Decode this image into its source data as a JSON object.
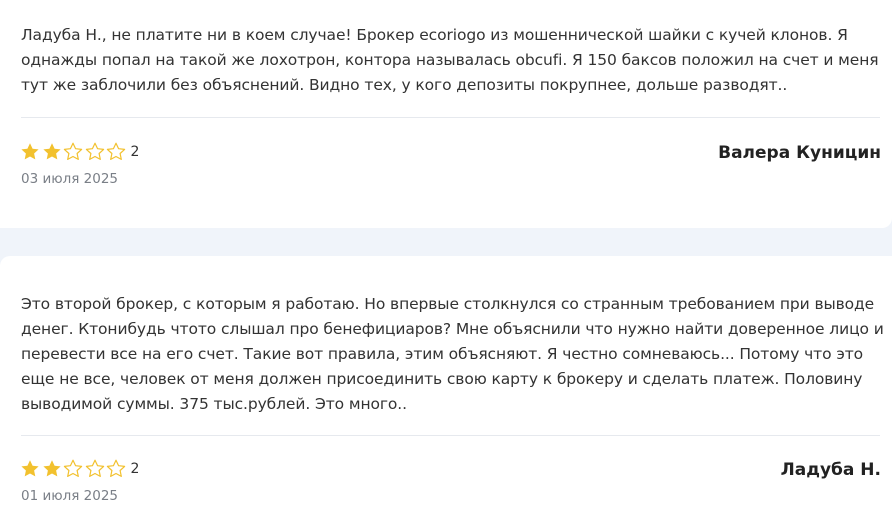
{
  "colors": {
    "star_filled": "#f2c12e",
    "star_empty_stroke": "#f2c12e",
    "background": "#f0f4fa",
    "card": "#ffffff"
  },
  "reviews": [
    {
      "text": "Ладуба Н., не платите ни в коем случае! Брокер ecoriogo из мошеннической шайки с кучей клонов. Я однажды попал на такой же лохотрон, контора называлась obcufi. Я 150 баксов положил на счет и меня тут же заблочили без объяснений. Видно тех, у кого депозиты покрупнее, дольше разводят..",
      "rating": 2,
      "rating_label": "2",
      "author": "Валера Куницин",
      "date": "03 июля 2025"
    },
    {
      "text": "Это второй брокер, с которым я работаю. Но впервые столкнулся со странным требованием при выводе денег. Ктонибудь чтото слышал про бенефициаров? Мне объяснили что нужно найти доверенное лицо и перевести все на его счет. Такие вот правила, этим объясняют. Я честно сомневаюсь... Потому что это еще не все, человек от меня должен присоединить свою карту к брокеру и сделать платеж. Половину выводимой суммы. 375 тыс.рублей. Это много..",
      "rating": 2,
      "rating_label": "2",
      "author": "Ладуба Н.",
      "date": "01 июля 2025"
    }
  ]
}
